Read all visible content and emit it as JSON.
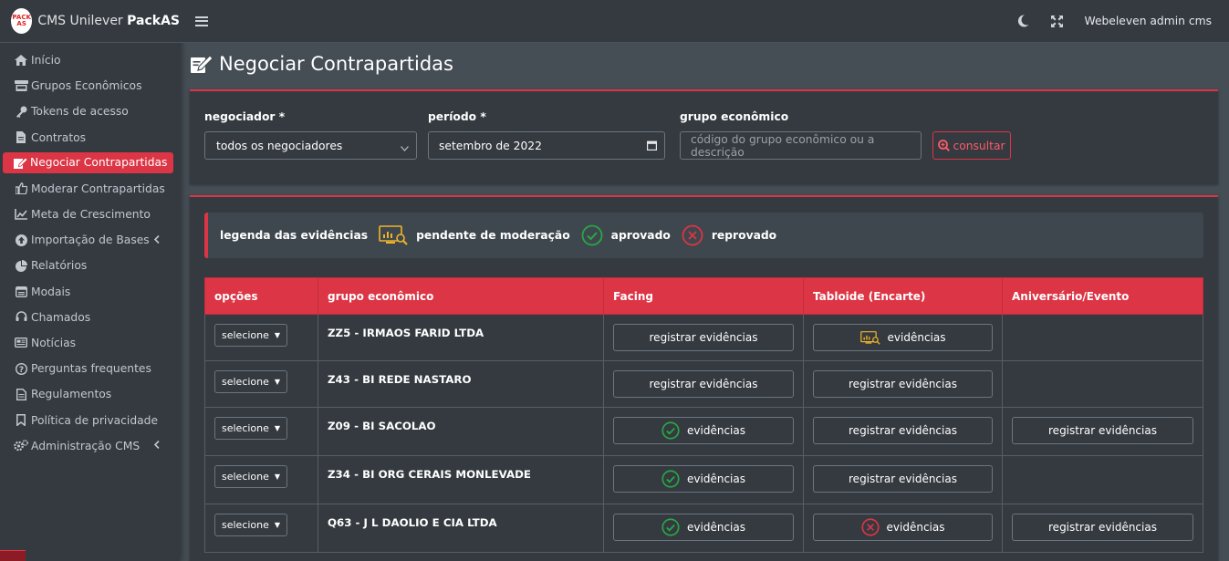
{
  "brand": {
    "logo_text": "PACK AS",
    "title_prefix": "CMS Unilever ",
    "title_bold": "PackAS"
  },
  "sidebar": {
    "items": [
      {
        "label": "Início",
        "icon": "home-icon"
      },
      {
        "label": "Grupos Econômicos",
        "icon": "store-icon"
      },
      {
        "label": "Tokens de acesso",
        "icon": "key-icon"
      },
      {
        "label": "Contratos",
        "icon": "file-icon"
      },
      {
        "label": "Negociar Contrapartidas",
        "icon": "edit-icon",
        "active": true
      },
      {
        "label": "Moderar Contrapartidas",
        "icon": "thumbs-up-icon"
      },
      {
        "label": "Meta de Crescimento",
        "icon": "chart-line-icon"
      },
      {
        "label": "Importação de Bases",
        "icon": "upload-icon",
        "has_caret": true
      },
      {
        "label": "Relatórios",
        "icon": "pie-chart-icon"
      },
      {
        "label": "Modais",
        "icon": "window-icon"
      },
      {
        "label": "Chamados",
        "icon": "headset-icon"
      },
      {
        "label": "Notícias",
        "icon": "newspaper-icon"
      },
      {
        "label": "Perguntas frequentes",
        "icon": "question-icon"
      },
      {
        "label": "Regulamentos",
        "icon": "document-icon"
      },
      {
        "label": "Política de privacidade",
        "icon": "bookmark-icon"
      },
      {
        "label": "Administração CMS",
        "icon": "cogs-icon",
        "has_caret": true
      }
    ]
  },
  "topbar": {
    "user": "Webeleven admin cms"
  },
  "page": {
    "title": "Negociar Contrapartidas"
  },
  "filters": {
    "negociador_label": "negociador *",
    "negociador_value": "todos os negociadores",
    "periodo_label": "período *",
    "periodo_value": "setembro de 2022",
    "grupo_label": "grupo econômico",
    "grupo_placeholder": "código do grupo econômico ou a descrição",
    "consultar_label": "consultar"
  },
  "legend": {
    "title": "legenda das evidências",
    "pendente": "pendente de moderação",
    "aprovado": "aprovado",
    "reprovado": "reprovado"
  },
  "table": {
    "headers": [
      "opções",
      "grupo econômico",
      "Facing",
      "Tabloide (Encarte)",
      "Aniversário/Evento"
    ],
    "select_label": "selecione",
    "rows": [
      {
        "grupo": "ZZ5 - IRMAOS FARID LTDA",
        "facing": "registrar evidências",
        "tabloide": "evidências",
        "aniversario": ""
      },
      {
        "grupo": "Z43 - BI REDE NASTARO",
        "facing": "registrar evidências",
        "tabloide": "registrar evidências",
        "aniversario": ""
      },
      {
        "grupo": "Z09 - BI SACOLAO",
        "facing": "evidências",
        "tabloide": "registrar evidências",
        "aniversario": "registrar evidências"
      },
      {
        "grupo": "Z34 - BI ORG CERAIS MONLEVADE",
        "facing": "evidências",
        "tabloide": "registrar evidências",
        "aniversario": ""
      },
      {
        "grupo": "Q63 - J L DAOLIO E CIA LTDA",
        "facing": "evidências",
        "tabloide": "evidências",
        "aniversario": "registrar evidências"
      }
    ]
  },
  "colors": {
    "accent": "#dc3545",
    "approved": "#28a745",
    "pending": "#f0b429"
  }
}
